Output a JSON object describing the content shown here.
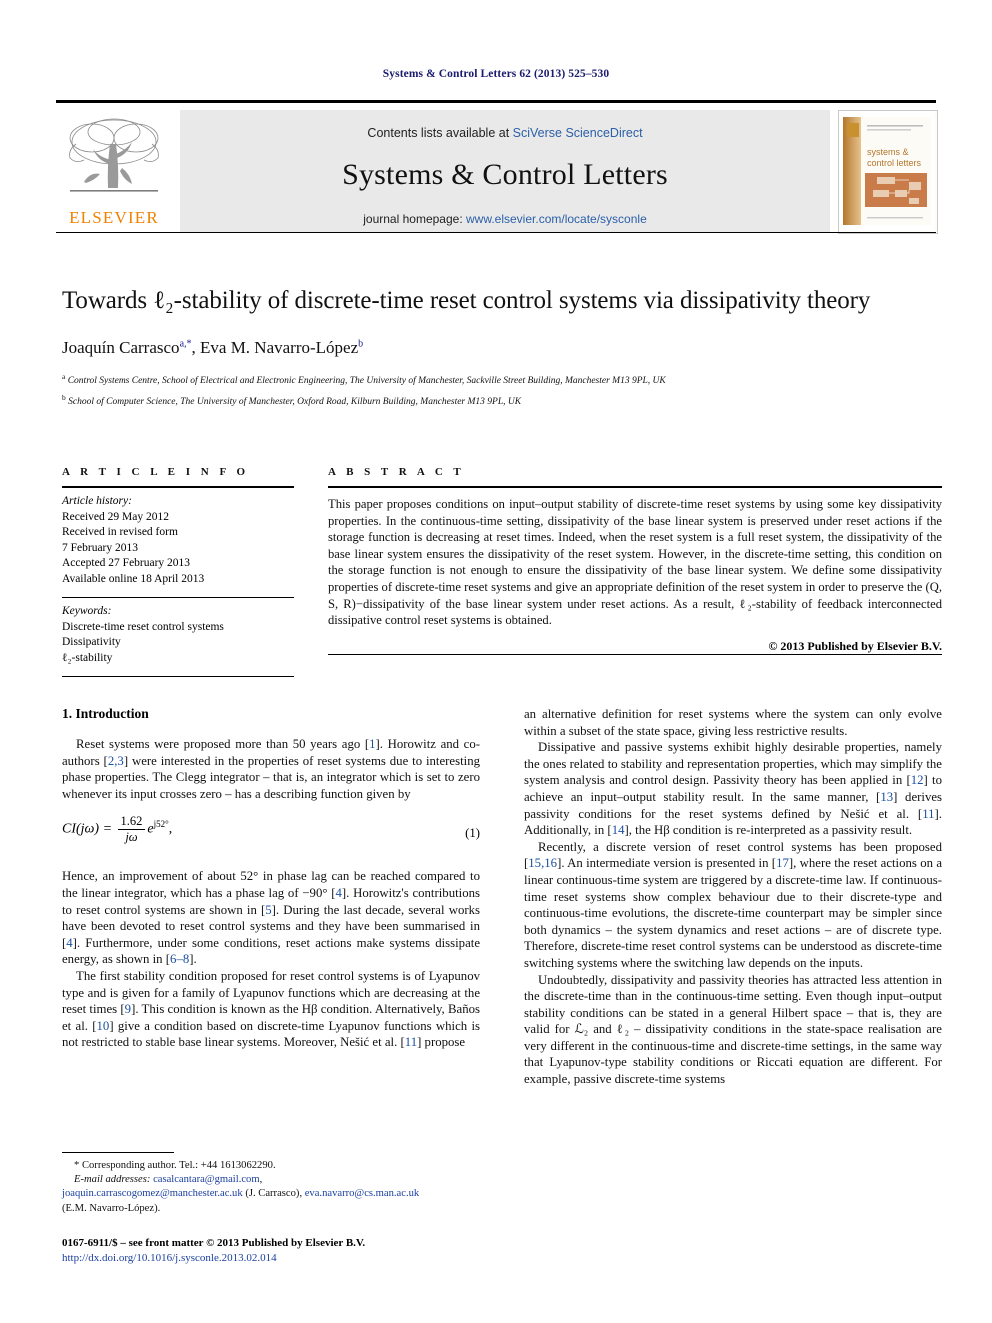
{
  "running_head": "Systems & Control Letters 62 (2013) 525–530",
  "masthead": {
    "contents_prefix": "Contents lists available at ",
    "contents_link": "SciVerse ScienceDirect",
    "journal_name": "Systems & Control Letters",
    "homepage_prefix": "journal homepage: ",
    "homepage_link": "www.elsevier.com/locate/sysconle",
    "publisher_wordmark": "ELSEVIER",
    "cover_title_line1": "systems &",
    "cover_title_line2": "control letters"
  },
  "title": "Towards ℓ₂-stability of discrete-time reset control systems via dissipativity theory",
  "authors": "Joaquín Carrasco a,*, Eva M. Navarro-López b",
  "affiliations": [
    "a Control Systems Centre, School of Electrical and Electronic Engineering, The University of Manchester, Sackville Street Building, Manchester M13 9PL, UK",
    "b School of Computer Science, The University of Manchester, Oxford Road, Kilburn Building, Manchester M13 9PL, UK"
  ],
  "article_info": {
    "heading": "A R T I C L E   I N F O",
    "history_label": "Article history:",
    "history": [
      "Received 29 May 2012",
      "Received in revised form",
      "7 February 2013",
      "Accepted 27 February 2013",
      "Available online 18 April 2013"
    ],
    "keywords_label": "Keywords:",
    "keywords": [
      "Discrete-time reset control systems",
      "Dissipativity",
      "ℓ₂-stability"
    ]
  },
  "abstract": {
    "heading": "A B S T R A C T",
    "text": "This paper proposes conditions on input–output stability of discrete-time reset systems by using some key dissipativity properties. In the continuous-time setting, dissipativity of the base linear system is preserved under reset actions if the storage function is decreasing at reset times. Indeed, when the reset system is a full reset system, the dissipativity of the base linear system ensures the dissipativity of the reset system. However, in the discrete-time setting, this condition on the storage function is not enough to ensure the dissipativity of the base linear system. We define some dissipativity properties of discrete-time reset systems and give an appropriate definition of the reset system in order to preserve the (Q, S, R)−dissipativity of the base linear system under reset actions. As a result, ℓ₂-stability of feedback interconnected dissipative control reset systems is obtained.",
    "copyright": "© 2013 Published by Elsevier B.V."
  },
  "body": {
    "section_heading": "1. Introduction",
    "left_p1": "Reset systems were proposed more than 50 years ago [1]. Horowitz and co-authors [2,3] were interested in the properties of reset systems due to interesting phase properties. The Clegg integrator – that is, an integrator which is set to zero whenever its input crosses zero – has a describing function given by",
    "equation": {
      "lhs": "CI(jω) =",
      "numerator": "1.62",
      "denominator": "jω",
      "exponential": "e",
      "exponent": "j52°",
      "trailing": ",",
      "number": "(1)"
    },
    "left_p2": "Hence, an improvement of about 52° in phase lag can be reached compared to the linear integrator, which has a phase lag of −90° [4]. Horowitz's contributions to reset control systems are shown in [5]. During the last decade, several works have been devoted to reset control systems and they have been summarised in [4]. Furthermore, under some conditions, reset actions make systems dissipate energy, as shown in [6–8].",
    "left_p3": "The first stability condition proposed for reset control systems is of Lyapunov type and is given for a family of Lyapunov functions which are decreasing at the reset times [9]. This condition is known as the Hβ condition. Alternatively, Baños et al. [10] give a condition based on discrete-time Lyapunov functions which is not restricted to stable base linear systems. Moreover, Nešić et al. [11] propose",
    "right_p1": "an alternative definition for reset systems where the system can only evolve within a subset of the state space, giving less restrictive results.",
    "right_p2": "Dissipative and passive systems exhibit highly desirable properties, namely the ones related to stability and representation properties, which may simplify the system analysis and control design. Passivity theory has been applied in [12] to achieve an input–output stability result. In the same manner, [13] derives passivity conditions for the reset systems defined by Nešić et al. [11]. Additionally, in [14], the Hβ condition is re-interpreted as a passivity result.",
    "right_p3": "Recently, a discrete version of reset control systems has been proposed [15,16]. An intermediate version is presented in [17], where the reset actions on a linear continuous-time system are triggered by a discrete-time law. If continuous-time reset systems show complex behaviour due to their discrete-type and continuous-time evolutions, the discrete-time counterpart may be simpler since both dynamics – the system dynamics and reset actions – are of discrete type. Therefore, discrete-time reset control systems can be understood as discrete-time switching systems where the switching law depends on the inputs.",
    "right_p4": "Undoubtedly, dissipativity and passivity theories has attracted less attention in the discrete-time than in the continuous-time setting. Even though input–output stability conditions can be stated in a general Hilbert space – that is, they are valid for ℒ₂ and ℓ₂ – dissipativity conditions in the state-space realisation are very different in the continuous-time and discrete-time settings, in the same way that Lyapunov-type stability conditions or Riccati equation are different. For example, passive discrete-time systems"
  },
  "footnote": {
    "corresponding": "* Corresponding author. Tel.: +44 1613062290.",
    "email_label": "E-mail addresses:",
    "email1": "casalcantara@gmail.com",
    "email2": "joaquin.carrascogomez@manchester.ac.uk",
    "email2_owner": "(J. Carrasco)",
    "email3": "eva.navarro@cs.man.ac.uk",
    "email3_owner": "(E.M. Navarro-López)."
  },
  "issn_line": "0167-6911/$ – see front matter © 2013 Published by Elsevier B.V.",
  "doi_line": "http://dx.doi.org/10.1016/j.sysconle.2013.02.014",
  "colors": {
    "elsevier_orange": "#ef8200",
    "link_blue": "#2b5fa8",
    "ref_blue": "#1a4fa0",
    "runhead_navy": "#1a1a6e"
  }
}
